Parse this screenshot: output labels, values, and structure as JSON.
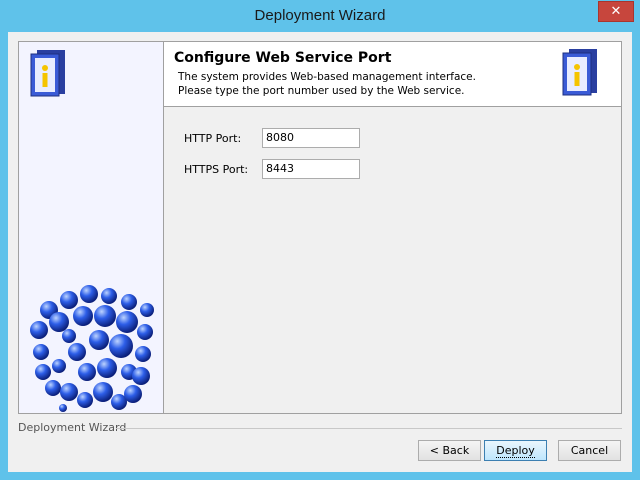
{
  "window": {
    "title": "Deployment Wizard",
    "close_glyph": "✕"
  },
  "header": {
    "title": "Configure Web Service Port",
    "line1": "The system provides Web-based management interface.",
    "line2": "Please type the port number used by the Web service."
  },
  "form": {
    "http_label": "HTTP Port:",
    "http_value": "8080",
    "https_label": "HTTPS Port:",
    "https_value": "8443"
  },
  "footer": {
    "group_label": "Deployment Wizard"
  },
  "buttons": {
    "back": "< Back",
    "deploy": "Deploy",
    "cancel": "Cancel"
  },
  "colors": {
    "titlebar": "#5fc2ea",
    "close": "#c7463d",
    "sphere": "#1f4fd6"
  }
}
